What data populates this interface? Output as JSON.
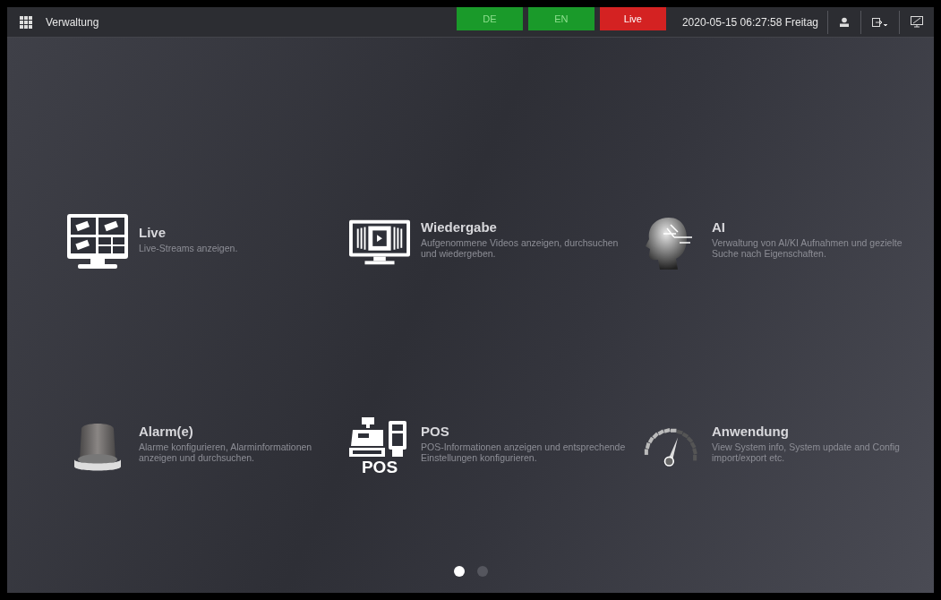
{
  "top_bar": {
    "title": "Verwaltung",
    "buttons": [
      {
        "label": "DE",
        "color": "#1a9a2a"
      },
      {
        "label": "EN",
        "color": "#1a9a2a"
      },
      {
        "label": "Live",
        "color": "#d42222"
      }
    ],
    "datetime": "2020-05-15 06:27:58 Freitag"
  },
  "tiles": [
    {
      "kind": "live",
      "title": "Live",
      "description": "Live-Streams anzeigen."
    },
    {
      "kind": "playback",
      "title": "Wiedergabe",
      "description": "Aufgenommene Videos anzeigen, durchsuchen und wiedergeben."
    },
    {
      "kind": "ai",
      "title": "AI",
      "description": "Verwaltung von AI/KI Aufnahmen und gezielte Suche nach Eigenschaften."
    },
    {
      "kind": "alarm",
      "title": "Alarm(e)",
      "description": "Alarme konfigurieren, Alarminformationen anzeigen und durchsuchen."
    },
    {
      "kind": "pos",
      "title": "POS",
      "icon_caption": "POS",
      "description": "POS-Informationen anzeigen und entsprechende Einstellungen konfigurieren."
    },
    {
      "kind": "gauge",
      "title": "Anwendung",
      "description": "View System info, System update and Config import/export etc."
    }
  ],
  "pages": [
    {
      "selected": true
    },
    {
      "selected": false
    }
  ]
}
